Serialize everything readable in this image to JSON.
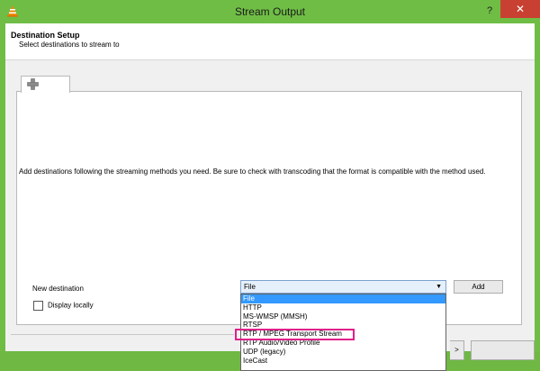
{
  "window": {
    "title": "Stream Output",
    "help_label": "?",
    "close_label": "✕"
  },
  "header": {
    "title": "Destination Setup",
    "subtitle": "Select destinations to stream to"
  },
  "tab": {
    "icon": "plus-icon"
  },
  "panel": {
    "info": "Add destinations following the streaming methods you need. Be sure to check with transcoding that the format is compatible with the method used."
  },
  "destination": {
    "label": "New destination",
    "selected": "File",
    "add_label": "Add",
    "options": [
      "File",
      "HTTP",
      "MS-WMSP (MMSH)",
      "RTSP",
      "RTP / MPEG Transport Stream",
      "RTP Audio/Video Profile",
      "UDP (legacy)",
      "IceCast"
    ]
  },
  "display_locally": {
    "label": "Display locally",
    "checked": false
  },
  "footer": {
    "next_label": ">"
  },
  "colors": {
    "titlebar": "#6fbd45",
    "close": "#c84031",
    "selection": "#3399ff",
    "highlight": "#e0208a"
  }
}
